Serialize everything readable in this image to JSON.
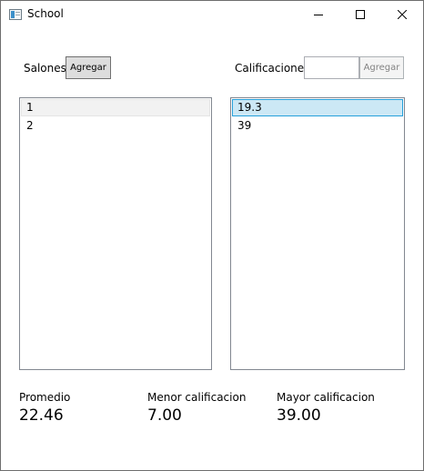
{
  "window": {
    "title": "School",
    "icon": "app-window-icon",
    "controls": [
      "minimize-icon",
      "maximize-icon",
      "close-icon"
    ]
  },
  "salones": {
    "label": "Salones",
    "add_label": "Agregar",
    "items": [
      "1",
      "2"
    ]
  },
  "calificaciones": {
    "label": "Calificaciones",
    "input_value": "",
    "add_label": "Agregar",
    "items": [
      "19.3",
      "39"
    ]
  },
  "stats": {
    "promedio_label": "Promedio",
    "promedio_value": "22.46",
    "menor_label": "Menor calificacion",
    "menor_value": "7.00",
    "mayor_label": "Mayor calificacion",
    "mayor_value": "39.00"
  },
  "colors": {
    "selection_bg": "#cce8f5",
    "selection_border": "#26a0da",
    "hover_bg": "#f2f2f2"
  }
}
